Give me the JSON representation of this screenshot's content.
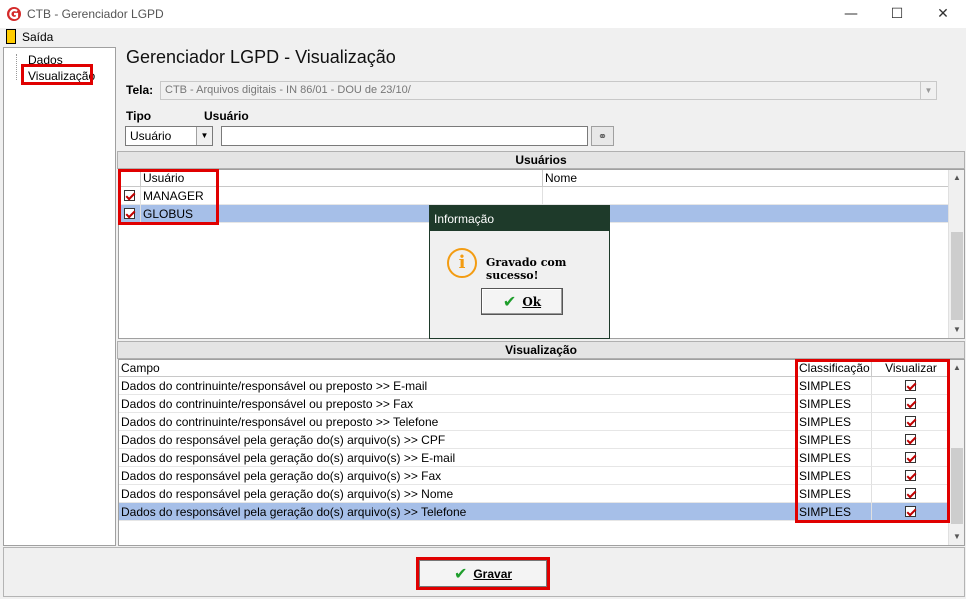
{
  "window": {
    "title": "CTB - Gerenciador LGPD",
    "minimize_icon": "minimize-icon",
    "maximize_icon": "maximize-icon",
    "close_icon": "close-icon"
  },
  "menu": {
    "exit_label": "Saída"
  },
  "tree": {
    "items": [
      "Dados",
      "Visualização"
    ],
    "selected": "Visualização"
  },
  "page_title": "Gerenciador LGPD - Visualização",
  "filters": {
    "tela_label": "Tela:",
    "tela_value": "CTB - Arquivos digitais - IN 86/01 - DOU de 23/10/",
    "tipo_label": "Tipo",
    "tipo_value": "Usuário",
    "usuario_label": "Usuário",
    "usuario_value": ""
  },
  "users_section": {
    "header": "Usuários",
    "columns": [
      "Usuário",
      "Nome"
    ],
    "rows": [
      {
        "checked": true,
        "usuario": "MANAGER",
        "nome": ""
      },
      {
        "checked": true,
        "usuario": "GLOBUS",
        "nome": "",
        "selected": true
      }
    ]
  },
  "visualization_section": {
    "header": "Visualização",
    "columns": [
      "Campo",
      "Classificação",
      "Visualizar"
    ],
    "rows": [
      {
        "campo": "Dados do contrinuinte/responsável ou preposto >> E-mail",
        "classificacao": "SIMPLES",
        "visualizar": true
      },
      {
        "campo": "Dados do contrinuinte/responsável ou preposto >> Fax",
        "classificacao": "SIMPLES",
        "visualizar": true
      },
      {
        "campo": "Dados do contrinuinte/responsável ou preposto >> Telefone",
        "classificacao": "SIMPLES",
        "visualizar": true
      },
      {
        "campo": "Dados do responsável pela geração do(s) arquivo(s) >> CPF",
        "classificacao": "SIMPLES",
        "visualizar": true
      },
      {
        "campo": "Dados do responsável pela geração do(s) arquivo(s) >> E-mail",
        "classificacao": "SIMPLES",
        "visualizar": true
      },
      {
        "campo": "Dados do responsável pela geração do(s) arquivo(s) >> Fax",
        "classificacao": "SIMPLES",
        "visualizar": true
      },
      {
        "campo": "Dados do responsável pela geração do(s) arquivo(s) >> Nome",
        "classificacao": "SIMPLES",
        "visualizar": true
      },
      {
        "campo": "Dados do responsável pela geração do(s) arquivo(s) >> Telefone",
        "classificacao": "SIMPLES",
        "visualizar": true,
        "selected": true
      }
    ]
  },
  "dialog": {
    "title": "Informação",
    "message": "Gravado com sucesso!",
    "ok_label": "Ok",
    "icon": "info-icon"
  },
  "footer": {
    "save_label": "Gravar"
  },
  "colors": {
    "highlight": "#e00000",
    "selection": "#a6bfe8",
    "dialog_title_bg": "#1e3a2a",
    "check_green": "#1f9e2c"
  }
}
